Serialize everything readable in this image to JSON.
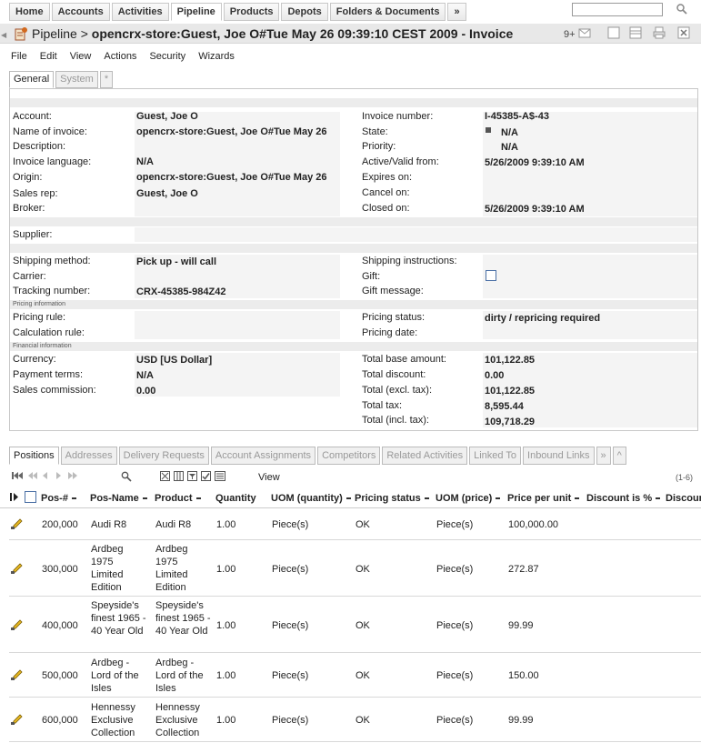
{
  "nav": {
    "tabs": [
      "Home",
      "Accounts",
      "Activities",
      "Pipeline",
      "Products",
      "Depots",
      "Folders & Documents",
      "»"
    ],
    "active_index": 3,
    "search_placeholder": ""
  },
  "title": {
    "module": "Pipeline",
    "separator": ">",
    "object": "opencrx-store:Guest, Joe O#Tue May 26 09:39:10 CEST 2009 - Invoice",
    "badge": "9+"
  },
  "menu": [
    "File",
    "Edit",
    "View",
    "Actions",
    "Security",
    "Wizards"
  ],
  "object_tabs": [
    "General",
    "System",
    "*"
  ],
  "sections": {
    "pricing": "Pricing information",
    "financial": "Financial information"
  },
  "fields": {
    "account": {
      "label": "Account:",
      "value": "Guest, Joe O"
    },
    "name": {
      "label": "Name of invoice:",
      "value": "opencrx-store:Guest, Joe O#Tue May 26"
    },
    "description": {
      "label": "Description:",
      "value": ""
    },
    "invoice_language": {
      "label": "Invoice language:",
      "value": "N/A"
    },
    "origin": {
      "label": "Origin:",
      "value": "opencrx-store:Guest, Joe O#Tue May 26"
    },
    "sales_rep": {
      "label": "Sales rep:",
      "value": "Guest, Joe O"
    },
    "broker": {
      "label": "Broker:",
      "value": ""
    },
    "invoice_number": {
      "label": "Invoice number:",
      "value": "I-45385-A$-43"
    },
    "state": {
      "label": "State:",
      "value": "N/A"
    },
    "priority": {
      "label": "Priority:",
      "value": "N/A"
    },
    "active_from": {
      "label": "Active/Valid from:",
      "value": "5/26/2009 9:39:10 AM"
    },
    "expires_on": {
      "label": "Expires on:",
      "value": ""
    },
    "cancel_on": {
      "label": "Cancel on:",
      "value": ""
    },
    "closed_on": {
      "label": "Closed on:",
      "value": "5/26/2009 9:39:10 AM"
    },
    "supplier": {
      "label": "Supplier:",
      "value": ""
    },
    "shipping_method": {
      "label": "Shipping method:",
      "value": "Pick up - will call"
    },
    "carrier": {
      "label": "Carrier:",
      "value": ""
    },
    "tracking_number": {
      "label": "Tracking number:",
      "value": "CRX-45385-984Z42"
    },
    "shipping_instructions": {
      "label": "Shipping instructions:",
      "value": ""
    },
    "gift": {
      "label": "Gift:",
      "value": ""
    },
    "gift_message": {
      "label": "Gift message:",
      "value": ""
    },
    "pricing_rule": {
      "label": "Pricing rule:",
      "value": ""
    },
    "calculation_rule": {
      "label": "Calculation rule:",
      "value": ""
    },
    "pricing_status": {
      "label": "Pricing status:",
      "value": "dirty / repricing required"
    },
    "pricing_date": {
      "label": "Pricing date:",
      "value": ""
    },
    "currency": {
      "label": "Currency:",
      "value": "USD [US Dollar]"
    },
    "payment_terms": {
      "label": "Payment terms:",
      "value": "N/A"
    },
    "sales_commission": {
      "label": "Sales commission:",
      "value": "0.00"
    },
    "total_base": {
      "label": "Total base amount:",
      "value": "101,122.85"
    },
    "total_discount": {
      "label": "Total discount:",
      "value": "0.00"
    },
    "total_excl_tax": {
      "label": "Total (excl. tax):",
      "value": "101,122.85"
    },
    "total_tax": {
      "label": "Total tax:",
      "value": "8,595.44"
    },
    "total_incl_tax": {
      "label": "Total (incl. tax):",
      "value": "109,718.29"
    }
  },
  "grid_tabs": [
    "Positions",
    "Addresses",
    "Delivery Requests",
    "Account Assignments",
    "Competitors",
    "Related Activities",
    "Linked To",
    "Inbound Links",
    "»",
    "^"
  ],
  "grid_toolbar": {
    "view_label": "View",
    "range": "(1-6)"
  },
  "columns": [
    "Pos-#",
    "Pos-Name",
    "Product",
    "Quantity",
    "UOM (quantity)",
    "Pricing status",
    "UOM (price)",
    "Price per unit",
    "Discount is %",
    "Discoun"
  ],
  "rows": [
    {
      "pos": "200,000",
      "name": "Audi R8",
      "product": "Audi R8",
      "qty": "1.00",
      "uom": "Piece(s)",
      "status": "OK",
      "uom_price": "Piece(s)",
      "price": "100,000.00"
    },
    {
      "pos": "300,000",
      "name": "Ardbeg 1975 Limited Edition",
      "product": "Ardbeg 1975 Limited Edition",
      "qty": "1.00",
      "uom": "Piece(s)",
      "status": "OK",
      "uom_price": "Piece(s)",
      "price": "272.87"
    },
    {
      "pos": "400,000",
      "name": "Speyside's finest 1965 - 40 Year Old",
      "product": "Speyside's finest 1965 - 40 Year Old",
      "qty": "1.00",
      "uom": "Piece(s)",
      "status": "OK",
      "uom_price": "Piece(s)",
      "price": "99.99"
    },
    {
      "pos": "500,000",
      "name": "Ardbeg - Lord of the Isles",
      "product": "Ardbeg - Lord of the Isles",
      "qty": "1.00",
      "uom": "Piece(s)",
      "status": "OK",
      "uom_price": "Piece(s)",
      "price": "150.00"
    },
    {
      "pos": "600,000",
      "name": "Hennessy Exclusive Collection",
      "product": "Hennessy Exclusive Collection",
      "qty": "1.00",
      "uom": "Piece(s)",
      "status": "OK",
      "uom_price": "Piece(s)",
      "price": "99.99"
    }
  ]
}
